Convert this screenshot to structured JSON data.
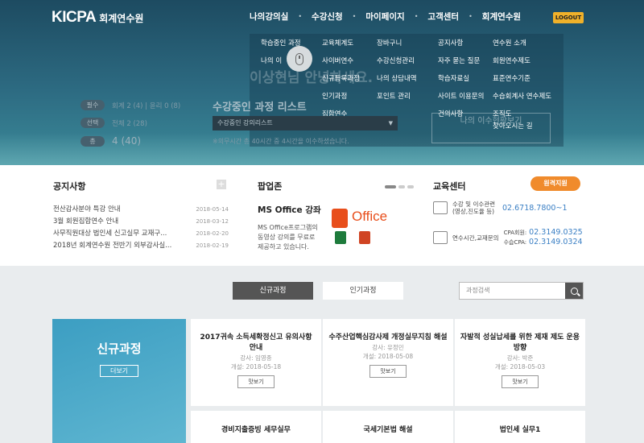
{
  "brand": {
    "logo": "KICPA",
    "name": "회계연수원"
  },
  "topnav": [
    "나의강의실",
    "수강신청",
    "마이페이지",
    "고객센터",
    "회계연수원"
  ],
  "logout": "LOGOUT",
  "menu": {
    "col1": [
      "학습중인 과정",
      "나의 이"
    ],
    "col2": [
      "교육체계도",
      "사이버연수",
      "신규등록과정",
      "인기과정",
      "집합연수"
    ],
    "col3": [
      "장바구니",
      "수강신청관리",
      "나의 상담내역",
      "포인트 관리"
    ],
    "col4": [
      "공지사항",
      "자주 묻는 질문",
      "학습자료실",
      "사이트 이용문의",
      "건의사항"
    ],
    "col5": [
      "연수원 소개",
      "회원연수제도",
      "표준연수기준",
      "수습회계사 연수제도",
      "조직도",
      "찾아오시는 길"
    ]
  },
  "hero": {
    "greeting": "이상현님 안녕하세요.",
    "stats": [
      {
        "label": "필수",
        "value": "회계 2 (4) | 윤리 0 (8)"
      },
      {
        "label": "선택",
        "value": "전체 2 (28)"
      },
      {
        "label": "총",
        "value": "4 (40)"
      }
    ],
    "learning_title": "수강중인 과정 리스트",
    "learning_select": "수강중인 강의리스트",
    "learning_note": "※의무시간 총 40시간 중 4시간을 이수하셨습니다.",
    "learning_btn": "나의 이수현황보기"
  },
  "notice": {
    "title": "공지사항",
    "items": [
      {
        "text": "전산감사분야 특강 안내",
        "date": "2018-05-14"
      },
      {
        "text": "3월 회원집합연수 안내",
        "date": "2018-03-12"
      },
      {
        "text": "사무직원대상 법인세 신고실무 교재구...",
        "date": "2018-02-20"
      },
      {
        "text": "2018년 회계연수원 전반기 외부감사실...",
        "date": "2018-02-19"
      }
    ]
  },
  "popup": {
    "title": "팝업존",
    "heading": "MS Office 강좌",
    "desc": "MS Office프로그램의 동영상 강의를 무료로 제공하고 있습니다.",
    "office_word": "Office"
  },
  "edu": {
    "title": "교육센터",
    "remote": "원격지원",
    "row1_label": "수강 및 이수관련 (영상,진도율 등)",
    "row1_num": "02.6718.7800~1",
    "row2_label": "연수시간,교재문의",
    "row2_a_label": "CPA회원:",
    "row2_a_num": "02.3149.0325",
    "row2_b_label": "수습CPA:",
    "row2_b_num": "02.3149.0324"
  },
  "tabs": {
    "active": "신규과정",
    "other": "인기과정"
  },
  "search": {
    "placeholder": "과정검색"
  },
  "featured": {
    "title": "신규과정",
    "more": "더보기"
  },
  "courses": [
    {
      "title": "2017귀속 소득세확정신고 유의사항 안내",
      "teacher": "강사: 임영종",
      "date": "개설: 2018-05-18",
      "btn": "맛보기"
    },
    {
      "title": "수주산업핵심감사제 개정실무지침 해설",
      "teacher": "강사: 유정민",
      "date": "개설: 2018-05-08",
      "btn": "맛보기"
    },
    {
      "title": "자발적 성실납세를 위한 제재 제도 운용방향",
      "teacher": "강사: 박준",
      "date": "개설: 2018-05-03",
      "btn": "맛보기"
    }
  ],
  "courses2": [
    "경비지출증빙 세무실무",
    "국세기본법 해설",
    "법인세 실무1"
  ]
}
